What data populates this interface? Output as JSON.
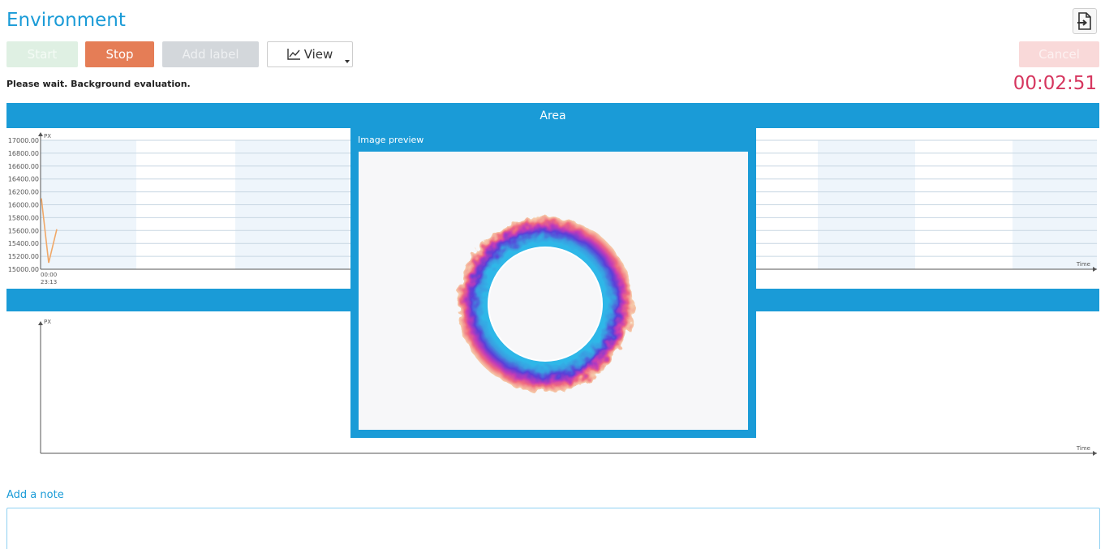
{
  "window": {
    "title": "Environment"
  },
  "toolbar": {
    "start_label": "Start",
    "stop_label": "Stop",
    "add_label_label": "Add label",
    "view_label": "View",
    "cancel_label": "Cancel"
  },
  "status": {
    "message": "Please wait. Background evaluation.",
    "timer": "00:02:51"
  },
  "area_panel": {
    "title": "Area"
  },
  "preview": {
    "title": "Image preview"
  },
  "note": {
    "label": "Add a note",
    "value": "",
    "placeholder": ""
  },
  "colors": {
    "accent": "#1a9bd7",
    "stop": "#e57d56",
    "timer": "#d6365f"
  },
  "chart_data": [
    {
      "type": "line",
      "ylabel": "PX",
      "xlabel": "Time",
      "yticks": [
        "17000.00",
        "16800.00",
        "16600.00",
        "16400.00",
        "16200.00",
        "16000.00",
        "15800.00",
        "15600.00",
        "15400.00",
        "15200.00",
        "15000.00"
      ],
      "xtick": [
        "00:00",
        "23:13"
      ],
      "ylim": [
        15000,
        17000
      ],
      "series": [
        {
          "color": "#f0a868",
          "values": [
            16100,
            15100,
            15620
          ]
        }
      ]
    },
    {
      "type": "line",
      "ylabel": "PX",
      "xlabel": "Time",
      "series": []
    }
  ]
}
